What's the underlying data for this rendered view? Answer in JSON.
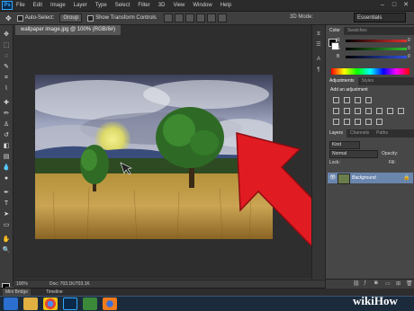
{
  "app": {
    "logo_text": "Ps",
    "title": "Adobe Photoshop"
  },
  "menu": [
    "File",
    "Edit",
    "Image",
    "Layer",
    "Type",
    "Select",
    "Filter",
    "3D",
    "View",
    "Window",
    "Help"
  ],
  "window_controls": {
    "minimize": "–",
    "maximize": "□",
    "close": "✕"
  },
  "options_bar": {
    "auto_select_label": "Auto-Select:",
    "auto_select_value": "Group",
    "show_transform_label": "Show Transform Controls",
    "mode_3d_label": "3D Mode:",
    "workspace": "Essentials"
  },
  "document": {
    "tab_title": "wallpaper image.jpg @ 100% (RGB/8#)",
    "zoom": "100%",
    "doc_info": "Doc: 703.1K/703.1K"
  },
  "bottom_panel": {
    "tabs": [
      "Mini Bridge",
      "Timeline"
    ]
  },
  "color_panel": {
    "tabs": [
      "Color",
      "Swatches"
    ],
    "sliders": [
      {
        "label": "R",
        "value": "0",
        "color": "#e03030"
      },
      {
        "label": "G",
        "value": "0",
        "color": "#30c030"
      },
      {
        "label": "B",
        "value": "0",
        "color": "#3050e0"
      }
    ]
  },
  "adjustments_panel": {
    "tabs": [
      "Adjustments",
      "Styles"
    ],
    "heading": "Add an adjustment"
  },
  "layers_panel": {
    "tabs": [
      "Layers",
      "Channels",
      "Paths"
    ],
    "kind_label": "Kind",
    "blend_mode": "Normal",
    "opacity_label": "Opacity:",
    "lock_label": "Lock:",
    "fill_label": "Fill:",
    "layer_name": "Background"
  },
  "taskbar": {
    "apps": [
      "internet-explorer",
      "file-explorer",
      "chrome",
      "photoshop",
      "app-grid",
      "firefox"
    ]
  },
  "watermark": "wikiHow",
  "colors": {
    "accent": "#31a8ff",
    "arrow": "#e11b22",
    "selected_layer": "#6a86ad",
    "taskbar": "#1c2b3c"
  }
}
